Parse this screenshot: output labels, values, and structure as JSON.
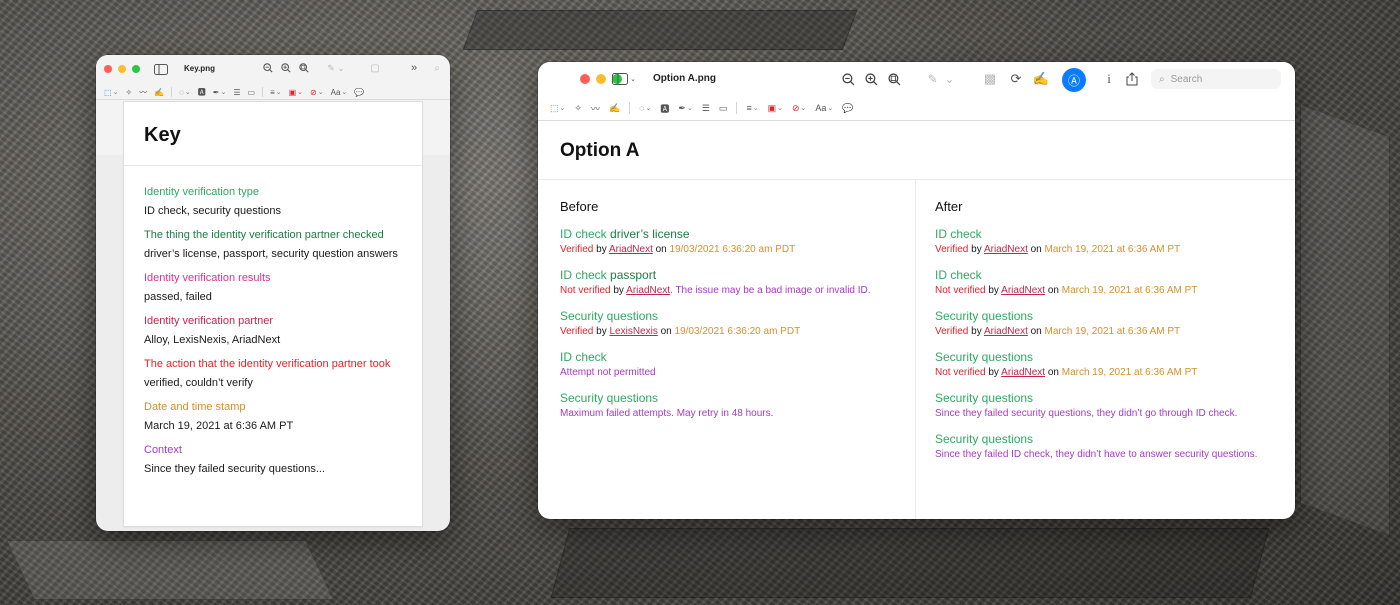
{
  "colors": {
    "type": "#2eaa63",
    "checked_item": "#1f7a43",
    "result_pass": "#e0345a",
    "result_fail": "#e0345a",
    "partner": "#c2264b",
    "action": "#d7262b",
    "timestamp": "#d4902a",
    "context": "#a33bc2",
    "text": "#1a1a1a"
  },
  "key_window": {
    "file_name": "Key.png",
    "title": "Key",
    "items": [
      {
        "label": "Identity verification type",
        "value": "ID check, security questions",
        "color": "#2eaa63"
      },
      {
        "label": "The thing the identity verification partner checked",
        "value": "driver’s license, passport, security question answers",
        "color": "#1f7a43"
      },
      {
        "label": "Identity verification results",
        "value": "passed, failed",
        "color": "#d9348e"
      },
      {
        "label": "Identity verification partner",
        "value": "Alloy, LexisNexis, AriadNext",
        "color": "#c2264b"
      },
      {
        "label": "The action that the identity verification partner took",
        "value": "verified, couldn’t verify",
        "color": "#d7262b"
      },
      {
        "label": "Date and time stamp",
        "value": "March 19, 2021 at 6:36 AM PT",
        "color": "#d4902a"
      },
      {
        "label": "Context",
        "value": "Since they failed security questions...",
        "color": "#a33bc2"
      }
    ]
  },
  "option_window": {
    "file_name": "Option A.png",
    "search_placeholder": "Search",
    "title": "Option A",
    "before": {
      "heading": "Before",
      "entries": [
        {
          "type": "ID check",
          "item": " driver’s license",
          "detail": [
            {
              "t": "Verified",
              "c": "action"
            },
            {
              "t": " by ",
              "c": "text"
            },
            {
              "t": "AriadNext",
              "c": "partner",
              "u": true
            },
            {
              "t": " on ",
              "c": "text"
            },
            {
              "t": "19/03/2021 6:36:20 am PDT",
              "c": "timestamp"
            }
          ]
        },
        {
          "type": "ID check",
          "item": " passport",
          "detail": [
            {
              "t": "Not verified",
              "c": "action"
            },
            {
              "t": " by ",
              "c": "text"
            },
            {
              "t": "AriadNext",
              "c": "partner",
              "u": true
            },
            {
              "t": ". The issue may be a bad image or invalid ID.",
              "c": "context"
            }
          ]
        },
        {
          "type": "Security questions",
          "item": "",
          "detail": [
            {
              "t": "Verified",
              "c": "action"
            },
            {
              "t": " by ",
              "c": "text"
            },
            {
              "t": "LexisNexis",
              "c": "partner",
              "u": true
            },
            {
              "t": " on ",
              "c": "text"
            },
            {
              "t": "19/03/2021 6:36:20 am PDT",
              "c": "timestamp"
            }
          ]
        },
        {
          "type": "ID check",
          "item": "",
          "detail": [
            {
              "t": "Attempt not permitted",
              "c": "context"
            }
          ]
        },
        {
          "type": "Security questions",
          "item": "",
          "detail": [
            {
              "t": "Maximum failed attempts. May retry in 48 hours.",
              "c": "context"
            }
          ]
        }
      ]
    },
    "after": {
      "heading": "After",
      "entries": [
        {
          "type": "ID check",
          "item": "",
          "detail": [
            {
              "t": "Verified",
              "c": "action"
            },
            {
              "t": " by ",
              "c": "text"
            },
            {
              "t": "AriadNext",
              "c": "partner",
              "u": true
            },
            {
              "t": " on ",
              "c": "text"
            },
            {
              "t": "March 19, 2021 at 6:36 AM PT",
              "c": "timestamp"
            }
          ]
        },
        {
          "type": "ID check",
          "item": "",
          "detail": [
            {
              "t": "Not verified",
              "c": "action"
            },
            {
              "t": " by ",
              "c": "text"
            },
            {
              "t": "AriadNext",
              "c": "partner",
              "u": true
            },
            {
              "t": " on ",
              "c": "text"
            },
            {
              "t": "March 19, 2021 at 6:36 AM PT",
              "c": "timestamp"
            }
          ]
        },
        {
          "type": "Security questions",
          "item": "",
          "detail": [
            {
              "t": "Verified",
              "c": "action"
            },
            {
              "t": " by ",
              "c": "text"
            },
            {
              "t": "AriadNext",
              "c": "partner",
              "u": true
            },
            {
              "t": " on ",
              "c": "text"
            },
            {
              "t": "March 19, 2021 at 6:36 AM PT",
              "c": "timestamp"
            }
          ]
        },
        {
          "type": "Security questions",
          "item": "",
          "detail": [
            {
              "t": "Not verified",
              "c": "action"
            },
            {
              "t": " by ",
              "c": "text"
            },
            {
              "t": "AriadNext",
              "c": "partner",
              "u": true
            },
            {
              "t": " on ",
              "c": "text"
            },
            {
              "t": "March 19, 2021 at 6:36 AM PT",
              "c": "timestamp"
            }
          ]
        },
        {
          "type": "Security questions",
          "item": "",
          "detail": [
            {
              "t": "Since they failed security questions, they didn’t go through ID check.",
              "c": "context"
            }
          ]
        },
        {
          "type": "Security questions",
          "item": "",
          "detail": [
            {
              "t": "Since they failed ID check, they didn’t have to answer security questions.",
              "c": "context"
            }
          ]
        }
      ]
    }
  },
  "icons": {
    "sidebar": "sidebar-toggle-icon",
    "zoom_out": "zoom-out-icon",
    "zoom_in": "zoom-in-icon",
    "zoom_fit": "zoom-fit-icon",
    "pen": "pen-icon",
    "more": "chevron-double-right-icon",
    "search": "search-icon",
    "markup": "markup-icon",
    "info": "info-icon",
    "share": "share-icon"
  }
}
